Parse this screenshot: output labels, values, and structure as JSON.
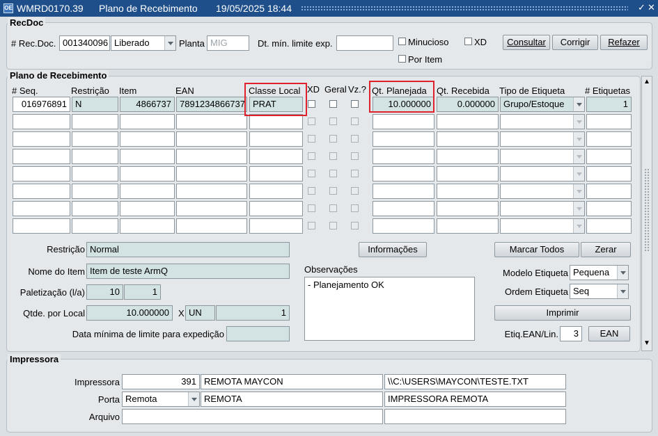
{
  "window": {
    "icon_text": "OE",
    "code": "WMRD0170.39",
    "title": "Plano de Recebimento",
    "datetime": "19/05/2025 18:44",
    "controls": [
      "✓",
      "✕"
    ]
  },
  "recdoc": {
    "section_title": "RecDoc",
    "rec_doc_label": "# Rec.Doc.",
    "rec_doc_value": "001340096",
    "status_value": "Liberado",
    "planta_label": "Planta",
    "planta_value": "MIG",
    "dt_min_label": "Dt. mín. limite exp.",
    "dt_min_value": "",
    "minucioso_label": "Minucioso",
    "xd_label": "XD",
    "por_item_label": "Por Item",
    "buttons": {
      "consultar": "Consultar",
      "corrigir": "Corrigir",
      "refazer": "Refazer"
    }
  },
  "plano": {
    "section_title": "Plano de Recebimento",
    "headers": {
      "seq": "# Seq.",
      "restricao": "Restrição",
      "item": "Item",
      "ean": "EAN",
      "classe_local": "Classe Local",
      "xd": "XD",
      "geral": "Geral",
      "vz": "Vz.?",
      "qt_planejada": "Qt. Planejada",
      "qt_recebida": "Qt. Recebida",
      "tipo_etiqueta": "Tipo de Etiqueta",
      "etiquetas": "# Etiquetas"
    },
    "rows": [
      {
        "seq": "016976891",
        "restricao": "N",
        "item": "4866737",
        "ean": "7891234866737",
        "classe_local": "PRAT",
        "qt_planejada": "10.000000",
        "qt_recebida": "0.000000",
        "tipo_etiqueta": "Grupo/Estoque",
        "etiquetas": "1"
      },
      {
        "seq": "",
        "restricao": "",
        "item": "",
        "ean": "",
        "classe_local": "",
        "qt_planejada": "",
        "qt_recebida": "",
        "tipo_etiqueta": "",
        "etiquetas": ""
      },
      {
        "seq": "",
        "restricao": "",
        "item": "",
        "ean": "",
        "classe_local": "",
        "qt_planejada": "",
        "qt_recebida": "",
        "tipo_etiqueta": "",
        "etiquetas": ""
      },
      {
        "seq": "",
        "restricao": "",
        "item": "",
        "ean": "",
        "classe_local": "",
        "qt_planejada": "",
        "qt_recebida": "",
        "tipo_etiqueta": "",
        "etiquetas": ""
      },
      {
        "seq": "",
        "restricao": "",
        "item": "",
        "ean": "",
        "classe_local": "",
        "qt_planejada": "",
        "qt_recebida": "",
        "tipo_etiqueta": "",
        "etiquetas": ""
      },
      {
        "seq": "",
        "restricao": "",
        "item": "",
        "ean": "",
        "classe_local": "",
        "qt_planejada": "",
        "qt_recebida": "",
        "tipo_etiqueta": "",
        "etiquetas": ""
      },
      {
        "seq": "",
        "restricao": "",
        "item": "",
        "ean": "",
        "classe_local": "",
        "qt_planejada": "",
        "qt_recebida": "",
        "tipo_etiqueta": "",
        "etiquetas": ""
      },
      {
        "seq": "",
        "restricao": "",
        "item": "",
        "ean": "",
        "classe_local": "",
        "qt_planejada": "",
        "qt_recebida": "",
        "tipo_etiqueta": "",
        "etiquetas": ""
      }
    ],
    "details": {
      "restricao_label": "Restrição",
      "restricao_value": "Normal",
      "nome_item_label": "Nome do Item",
      "nome_item_value": "Item de teste ArmQ",
      "paletizacao_label": "Paletização (l/a)",
      "paletizacao_l": "10",
      "paletizacao_a": "1",
      "qtde_local_label": "Qtde. por Local",
      "qtde_local_value": "10.000000",
      "x_label": "X",
      "unidade_value": "UN",
      "qtde_unidade_value": "1",
      "data_minima_label": "Data mínima de limite para expedição",
      "data_minima_value": "",
      "informacoes_button": "Informações",
      "observacoes_label": "Observações",
      "observacoes_value": "- Planejamento OK",
      "marcar_todos_button": "Marcar Todos",
      "zerar_button": "Zerar",
      "modelo_etiqueta_label": "Modelo Etiqueta",
      "modelo_etiqueta_value": "Pequena",
      "ordem_etiqueta_label": "Ordem Etiqueta",
      "ordem_etiqueta_value": "Seq",
      "imprimir_button": "Imprimir",
      "etiq_ean_label": "Etiq.EAN/Lin.",
      "etiq_ean_value": "3",
      "ean_button": "EAN"
    }
  },
  "impressora": {
    "section_title": "Impressora",
    "impressora_label": "Impressora",
    "impressora_code": "391",
    "impressora_name": "REMOTA MAYCON",
    "impressora_path": "\\\\C:\\USERS\\MAYCON\\TESTE.TXT",
    "porta_label": "Porta",
    "porta_value": "Remota",
    "porta_name": "REMOTA",
    "porta_desc": "IMPRESSORA REMOTA",
    "arquivo_label": "Arquivo",
    "arquivo_value": "",
    "arquivo_extra": ""
  },
  "colors": {
    "titlebar": "#1f4f8a",
    "readonly_field": "#d3e3e3",
    "highlight_box": "#e0202a"
  }
}
